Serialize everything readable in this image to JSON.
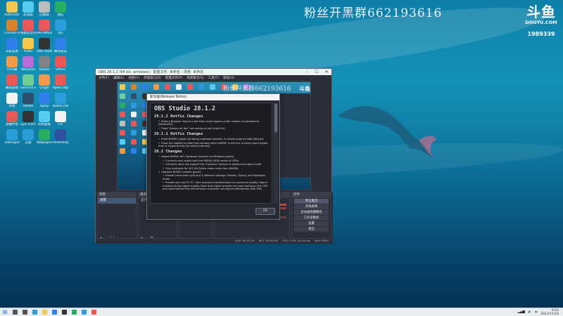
{
  "overlay": {
    "qq_group_text": "粉丝开黑群662193616",
    "douyu_logo_text": "斗鱼",
    "douyu_site": "DOUYU.COM",
    "douyu_room": "1989339"
  },
  "desktop": {
    "icons": [
      {
        "name": "Administrator",
        "icon": "user-folder-icon",
        "color": "#f2c94c"
      },
      {
        "name": "Counter-Strike Global Off...",
        "icon": "csgo-icon",
        "color": "#d9822b"
      },
      {
        "name": "火影忍者",
        "icon": "game-icon",
        "color": "#2f80ed"
      },
      {
        "name": "YY开播",
        "icon": "yy-icon",
        "color": "#f2994a"
      },
      {
        "name": "腾讯游戏",
        "icon": "tencent-icon",
        "color": "#eb5757"
      },
      {
        "name": "文档",
        "icon": "document-icon",
        "color": "#f2f2f2"
      },
      {
        "name": "直播伴侣",
        "icon": "live-icon",
        "color": "#eb5757"
      },
      {
        "name": "TeamSpeak",
        "icon": "teamspeak-icon",
        "color": "#2d9cdb"
      },
      {
        "name": "此电脑",
        "icon": "computer-icon",
        "color": "#56ccf2"
      },
      {
        "name": "网易云音乐",
        "icon": "music-icon",
        "color": "#eb5757"
      },
      {
        "name": "PUBG",
        "icon": "pubg-icon",
        "color": "#f2c94c"
      },
      {
        "name": "WeGame",
        "icon": "wegame-icon",
        "color": "#bb6bd9"
      },
      {
        "name": "GeForce Experience",
        "icon": "nvidia-icon",
        "color": "#6fcf97"
      },
      {
        "name": "Steam",
        "icon": "steam-icon",
        "color": "#2f4f6f"
      },
      {
        "name": "Epic Games",
        "icon": "epic-icon",
        "color": "#333333"
      },
      {
        "name": "迅雷",
        "icon": "thunder-icon",
        "color": "#2d9cdb"
      },
      {
        "name": "回收站",
        "icon": "recycle-bin-icon",
        "color": "#bdbdbd"
      },
      {
        "name": "MSI Afterburner",
        "icon": "afterburner-icon",
        "color": "#eb5757"
      },
      {
        "name": "OBS Studio",
        "icon": "obs-icon",
        "color": "#333333"
      },
      {
        "name": "Oculus",
        "icon": "oculus-icon",
        "color": "#828282"
      },
      {
        "name": "Origin",
        "icon": "origin-icon",
        "color": "#f2994a"
      },
      {
        "name": "Uplay",
        "icon": "uplay-icon",
        "color": "#2f80ed"
      },
      {
        "name": "控制面板",
        "icon": "control-panel-icon",
        "color": "#56ccf2"
      },
      {
        "name": "Wallpaper",
        "icon": "wallpaper-icon",
        "color": "#27ae60"
      },
      {
        "name": "微信",
        "icon": "wechat-icon",
        "color": "#27ae60"
      },
      {
        "name": "QQ",
        "icon": "qq-icon",
        "color": "#2d9cdb"
      },
      {
        "name": "腾讯会议",
        "icon": "meeting-icon",
        "color": "#2f80ed"
      },
      {
        "name": "Office",
        "icon": "office-icon",
        "color": "#eb5757"
      },
      {
        "name": "Apex Legends",
        "icon": "apex-icon",
        "color": "#eb5757"
      },
      {
        "name": "Battle.net",
        "icon": "battlenet-icon",
        "color": "#2d9cdb"
      },
      {
        "name": "EA",
        "icon": "ea-icon",
        "color": "#f2f2f2"
      },
      {
        "name": "Photoshop",
        "icon": "photoshop-icon",
        "color": "#2f4f9f"
      }
    ]
  },
  "obs": {
    "title": "OBS 28.1.2 (64 bit, windows) - 配置文件: 未命名 - 场景: 未命名",
    "menu": [
      "文件(F)",
      "编辑(E)",
      "视图(V)",
      "停靠窗口(D)",
      "配置文件(P)",
      "场景集合(S)",
      "工具(T)",
      "帮助(H)"
    ],
    "preview_overlay_text": "粉丝开黑群662193616",
    "preview_douyu": "斗鱼",
    "docks": {
      "scenes_title": "场景",
      "scenes": [
        "场景"
      ],
      "sources_title": "来源",
      "sources": [
        "显示器采集"
      ],
      "transition_buttons": [
        "淡出(300ms)",
        "持续时间"
      ],
      "mixer_title": "音频混音器",
      "mixer": [
        {
          "label": "桌面音频",
          "level": 0.72
        },
        {
          "label": "麦克风/Aux",
          "level": 0.4
        }
      ],
      "controls_title": "控件",
      "controls": [
        "停止推流",
        "开始录制",
        "启动虚拟摄像机",
        "工作室模式",
        "设置",
        "退出"
      ]
    },
    "status": [
      "LIVE: 00:12:34",
      "REC: 00:00:00",
      "CPU: 2.4%, 60.00 fps",
      "kb/s: 6000"
    ]
  },
  "release_notes": {
    "title": "新功能(Release Notes)",
    "heading": "OBS Studio 28.1.2",
    "sections": [
      {
        "title": "28.1.2 Hotfix Changes",
        "items": [
          {
            "text": "Fixed a Browser Source crash that could happen under certain circumstances [WizardCM]",
            "sub": false
          },
          {
            "text": "Fixed \"Always on Top\" not saving on exit [notr1ch]",
            "sub": false
          }
        ]
      },
      {
        "title": "28.1.1 Hotfix Changes",
        "items": [
          {
            "text": "Fixed NVENC preset not being migrated properly in simple output mode [derrod]",
            "sub": false
          },
          {
            "text": "Fixed the inability to start the encoder when NVENC is set to a b-frame count higher than is supported by the device [derrod]",
            "sub": false
          }
        ]
      },
      {
        "title": "28.1 Changes",
        "items": [
          {
            "text": "Added NVENC AV1 hardware encoder on Windows [jpark]",
            "sub": false
          },
          {
            "text": "Currently only works with the NVIDIA 40XX series of GPUs",
            "sub": true
          },
          {
            "text": "Currently does not support the \"Lossless\" feature in advanced output mode",
            "sub": true
          },
          {
            "text": "Only available for AV1 NV-Series video cards from NVIDIA",
            "sub": true
          },
          {
            "text": "Updated NVENC presets [jpark]",
            "sub": false
          },
          {
            "text": "Presets have been split into 3 different settings: Presets, Tuning, and Multipass mode",
            "sub": true
          },
          {
            "text": "Presets are now P1-P7, from maximum performance to maximum quality. Higher numbers bring higher quality. Note that higher presets are more taxing on the GPU and could impact the performance of games running simultaneously with OBS.",
            "sub": true
          }
        ]
      }
    ],
    "ok_label": "OK"
  },
  "taskbar": {
    "apps": [
      {
        "icon": "search-icon",
        "color": "#555555"
      },
      {
        "icon": "task-view-icon",
        "color": "#555555"
      },
      {
        "icon": "edge-icon",
        "color": "#2d9cdb"
      },
      {
        "icon": "explorer-icon",
        "color": "#f2c94c"
      },
      {
        "icon": "store-icon",
        "color": "#2f80ed"
      },
      {
        "icon": "obs-taskbar-icon",
        "color": "#333333"
      },
      {
        "icon": "wechat-taskbar-icon",
        "color": "#27ae60"
      },
      {
        "icon": "qq-taskbar-icon",
        "color": "#2d9cdb"
      },
      {
        "icon": "browser-taskbar-icon",
        "color": "#eb5757"
      }
    ],
    "tray": {
      "lang": "中",
      "time": "9:10",
      "date": "2022/11/24"
    }
  }
}
